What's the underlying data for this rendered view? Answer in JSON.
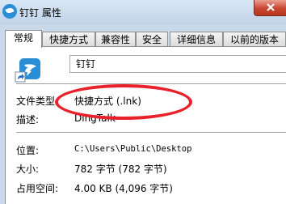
{
  "window": {
    "title": "钉钉 属性",
    "close_icon": "close-icon"
  },
  "tabs": [
    {
      "label": "常规"
    },
    {
      "label": "快捷方式"
    },
    {
      "label": "兼容性"
    },
    {
      "label": "安全"
    },
    {
      "label": "详细信息"
    },
    {
      "label": "以前的版本"
    }
  ],
  "general": {
    "name": "钉钉",
    "rows": {
      "file_type": {
        "label": "文件类型",
        "value": "快捷方式 (.lnk)"
      },
      "description": {
        "label": "描述:",
        "value": "DingTalk"
      },
      "location": {
        "label": "位置:",
        "value": "C:\\Users\\Public\\Desktop"
      },
      "size": {
        "label": "大小:",
        "value": "782 字节 (782 字节)"
      },
      "size_on_disk": {
        "label": "占用空间:",
        "value": "4.00 KB (4,096 字节)"
      }
    }
  },
  "annotation_color": "#e8212b"
}
